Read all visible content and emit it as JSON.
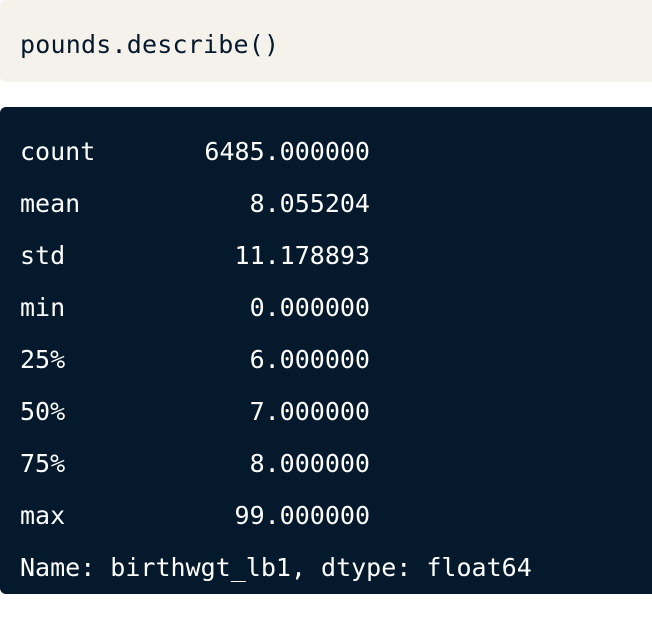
{
  "code": {
    "input": "pounds.describe()"
  },
  "output": {
    "rows": [
      {
        "label": "count",
        "value": "6485.000000"
      },
      {
        "label": "mean",
        "value": "8.055204"
      },
      {
        "label": "std",
        "value": "11.178893"
      },
      {
        "label": "min",
        "value": "0.000000"
      },
      {
        "label": "25%",
        "value": "6.000000"
      },
      {
        "label": "50%",
        "value": "7.000000"
      },
      {
        "label": "75%",
        "value": "8.000000"
      },
      {
        "label": "max",
        "value": "99.000000"
      }
    ],
    "footer": "Name: birthwgt_lb1, dtype: float64"
  },
  "colors": {
    "code_background": "#f5f2ec",
    "code_text": "#05192d",
    "output_background": "#05192d",
    "output_text": "#ffffff"
  }
}
